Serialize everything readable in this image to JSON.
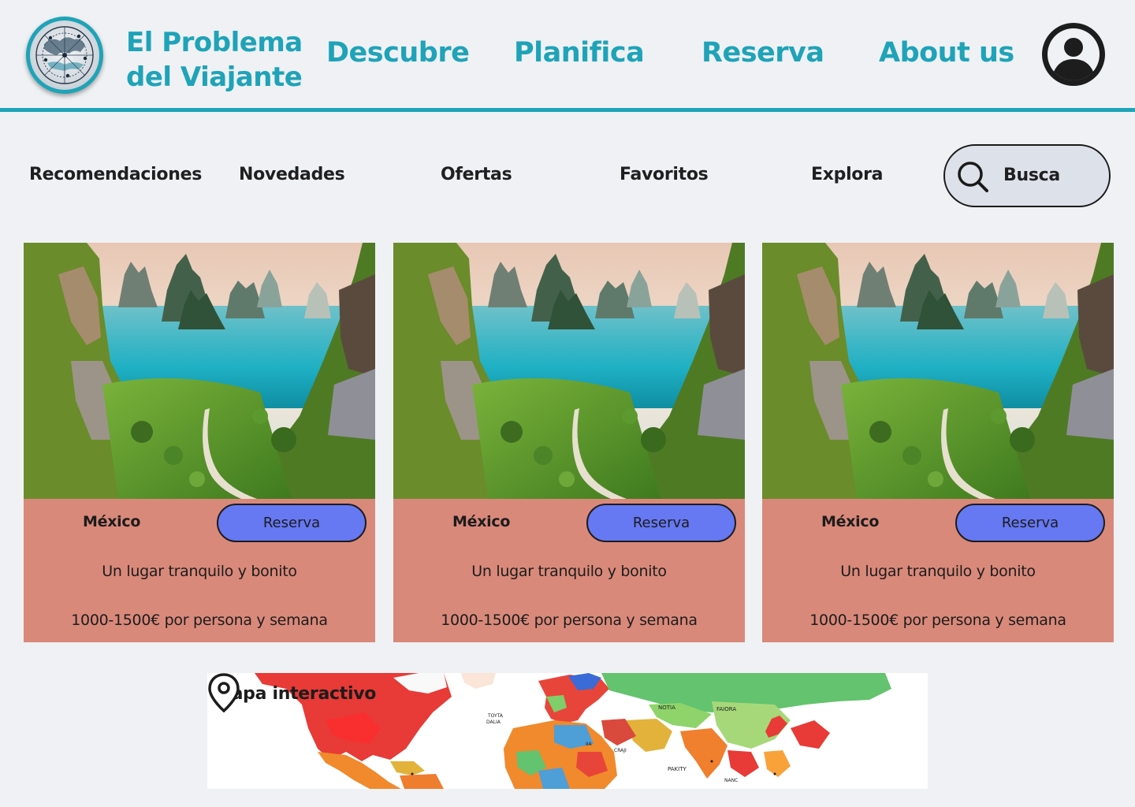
{
  "header": {
    "brand_line1": "El Problema",
    "brand_line2": "del Viajante",
    "nav": {
      "descubre": "Descubre",
      "planifica": "Planifica",
      "reserva": "Reserva",
      "about": "About us"
    },
    "logo_icon": "compass-globe-logo",
    "avatar_icon": "user-avatar-icon"
  },
  "subnav": {
    "recomendaciones": "Recomendaciones",
    "novedades": "Novedades",
    "ofertas": "Ofertas",
    "favoritos": "Favoritos",
    "explora": "Explora",
    "search_label": "Busca",
    "search_icon": "search-icon"
  },
  "cards": [
    {
      "country": "México",
      "button": "Reserva",
      "description": "Un lugar tranquilo y bonito",
      "price": "1000-1500€ por persona y semana"
    },
    {
      "country": "México",
      "button": "Reserva",
      "description": "Un lugar tranquilo y bonito",
      "price": "1000-1500€ por persona y semana"
    },
    {
      "country": "México",
      "button": "Reserva",
      "description": "Un lugar tranquilo y bonito",
      "price": "1000-1500€ por persona y semana"
    }
  ],
  "map": {
    "title": "Mapa interactivo",
    "pin_icon": "location-pin-icon"
  },
  "colors": {
    "accent": "#1fa3b8",
    "background": "#eff1f5",
    "card": "#d9897a",
    "button": "#6678f2",
    "search_bg": "#dde2ea"
  }
}
